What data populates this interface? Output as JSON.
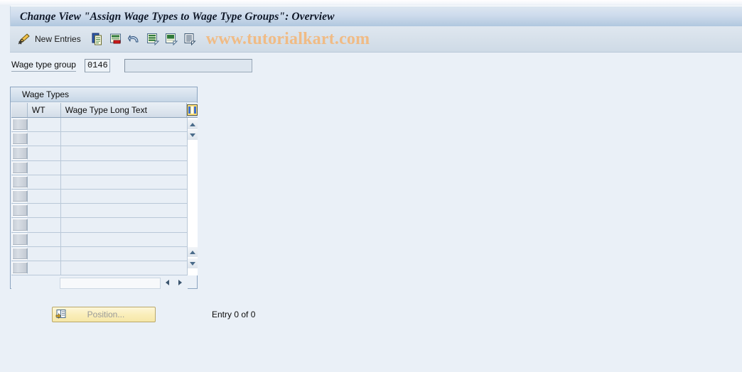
{
  "window": {
    "title": "Change View \"Assign Wage Types to Wage Type Groups\": Overview"
  },
  "toolbar": {
    "edit_icon": "pencil-icon",
    "new_entries_label": "New Entries",
    "icons": [
      {
        "name": "copy-icon"
      },
      {
        "name": "delete-row-icon"
      },
      {
        "name": "undo-icon"
      },
      {
        "name": "select-all-icon"
      },
      {
        "name": "deselect-all-icon"
      },
      {
        "name": "details-icon"
      }
    ],
    "watermark": "www.tutorialkart.com"
  },
  "form": {
    "wage_type_group_label": "Wage type group",
    "wage_type_group_value": "0146",
    "wage_type_group_text": "",
    "wage_type_group_text_placeholder": ""
  },
  "table": {
    "panel_title": "Wage Types",
    "columns": [
      {
        "key": "wt",
        "label": "WT"
      },
      {
        "key": "long_text",
        "label": "Wage Type Long Text"
      }
    ],
    "config_icon": "column-config-icon",
    "rows": [
      {
        "wt": "",
        "long_text": ""
      },
      {
        "wt": "",
        "long_text": ""
      },
      {
        "wt": "",
        "long_text": ""
      },
      {
        "wt": "",
        "long_text": ""
      },
      {
        "wt": "",
        "long_text": ""
      },
      {
        "wt": "",
        "long_text": ""
      },
      {
        "wt": "",
        "long_text": ""
      },
      {
        "wt": "",
        "long_text": ""
      },
      {
        "wt": "",
        "long_text": ""
      },
      {
        "wt": "",
        "long_text": ""
      },
      {
        "wt": "",
        "long_text": ""
      }
    ],
    "scroll": {
      "up_icon": "scroll-up-icon",
      "down_icon": "scroll-down-icon",
      "left_icon": "scroll-left-icon",
      "right_icon": "scroll-right-icon"
    }
  },
  "footer": {
    "position_button_label": "Position...",
    "position_icon": "position-icon",
    "entry_status": "Entry 0 of 0"
  },
  "colors": {
    "title_bar": "#bdd0e4",
    "toolbar": "#d6e0ea",
    "body": "#eaf0f7",
    "panel_border": "#8ba4c0",
    "watermark": "#f0bb85",
    "button_yellow": "#faeeba",
    "grid_line": "#b9c8d8"
  }
}
